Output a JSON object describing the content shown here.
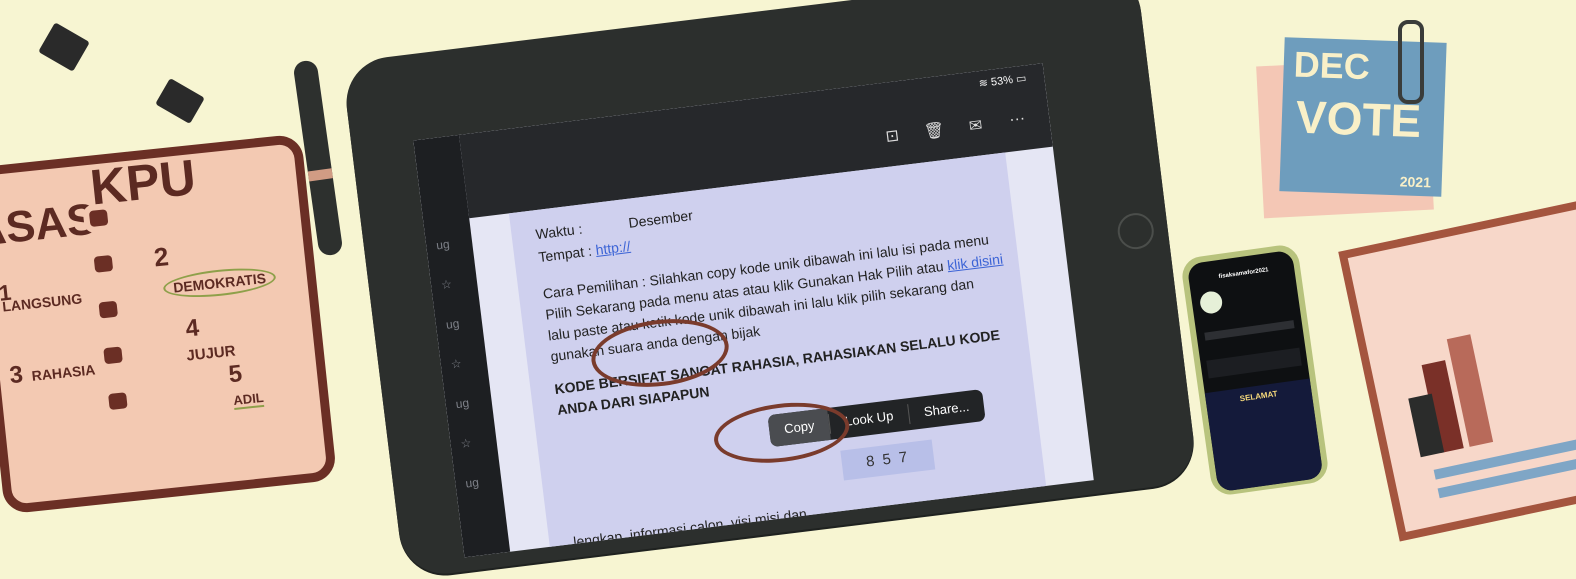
{
  "status": {
    "battery": "53%"
  },
  "doc": {
    "line_top": "Waktu :            Desember",
    "tempat_label": "Tempat :",
    "tempat_link": "http://",
    "para1": "Cara Pemilihan : Silahkan copy kode unik dibawah ini lalu isi pada menu Pilih Sekarang pada menu atas atau klik Gunakan Hak Pilih atau",
    "para1_link": "klik disini",
    "para1_end": "lalu paste atau ketik kode unik dibawah ini lalu klik pilih sekarang dan gunakan suara anda dengan bijak",
    "warning": "KODE BERSIFAT SANGAT RAHASIA, RAHASIAKAN SELALU KODE ANDA DARI SIAPAPUN",
    "code": "8  5 7",
    "bottom": "lengkap, informasi calon, visi misi dan"
  },
  "context_menu": {
    "copy": "Copy",
    "lookup": "Look Up",
    "share": "Share..."
  },
  "sidebar_fragments": [
    "ug",
    "ug",
    "ug",
    "ug"
  ],
  "toolbar_icons": [
    "archive-icon",
    "trash-icon",
    "mail-icon",
    "more-icon"
  ],
  "notebook": {
    "heading_left": "ASAS",
    "heading_right": "KPU",
    "n1": "1",
    "l1": "LANGSUNG",
    "n2": "2",
    "l2": "DEMOKRATIS",
    "n3": "3",
    "l3": "RAHASIA",
    "n4": "4",
    "l4": "JUJUR",
    "n5": "5",
    "l5": "ADIL"
  },
  "note": {
    "dec": "DEC",
    "vote": "VOTE",
    "year": "2021"
  },
  "phone": {
    "title": "fisaksamafor2021",
    "greeting": "SELAMAT"
  },
  "colors": {
    "background": "#f7f5d2",
    "tablet": "#2c2f2d",
    "screen": "#cfd0ee",
    "highlight": "#7a3b2c"
  }
}
